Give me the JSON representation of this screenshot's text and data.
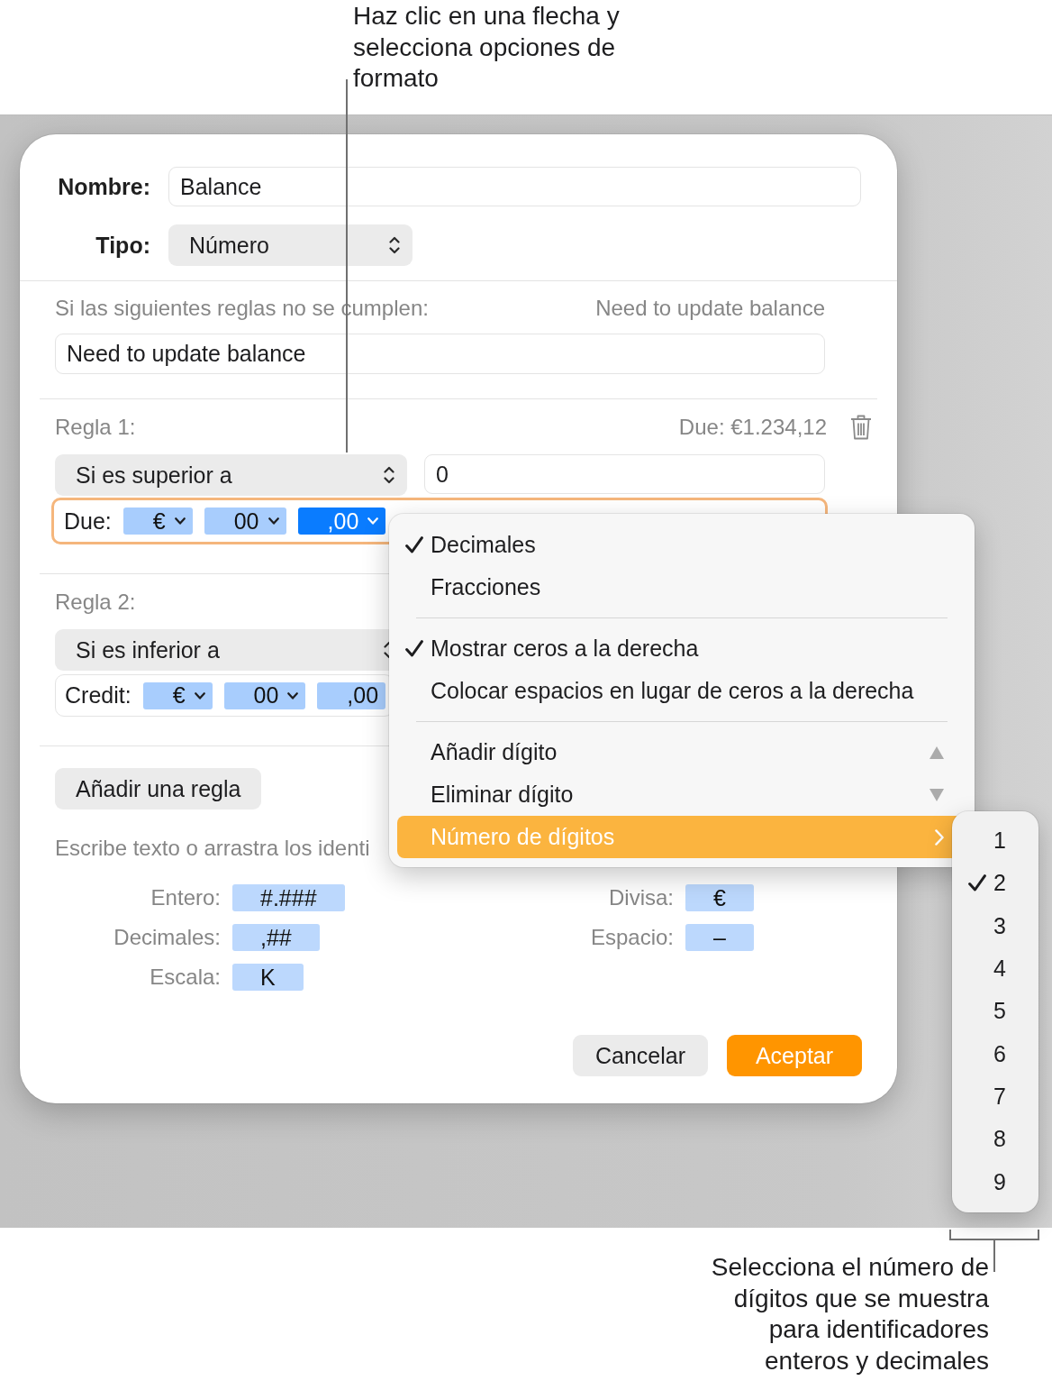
{
  "annotations": {
    "top": "Haz clic en una flecha y selecciona opciones de formato",
    "bottom": "Selecciona el número de dígitos que se muestra para identificadores enteros y decimales"
  },
  "dialog": {
    "fields": [
      {
        "label": "Nombre:",
        "kind": "text",
        "value": "Balance"
      },
      {
        "label": "Tipo:",
        "kind": "select",
        "value": "Número"
      }
    ],
    "fallback": {
      "label": "Si las siguientes reglas no se cumplen:",
      "preview": "Need to update balance",
      "value": "Need to update balance"
    },
    "rules": [
      {
        "label": "Regla 1:",
        "preview": "Due: €1.234,12",
        "condition": "Si es superior a",
        "value": "0",
        "format": {
          "label": "Due:",
          "focused": true,
          "tokens": [
            {
              "text": "€",
              "selected": false,
              "dropdown": true
            },
            {
              "text": "00",
              "selected": false,
              "dropdown": true
            },
            {
              "text": ",00",
              "selected": true,
              "dropdown": true
            }
          ]
        }
      },
      {
        "label": "Regla 2:",
        "condition": "Si es inferior a",
        "format": {
          "label": "Credit:",
          "focused": false,
          "tokens": [
            {
              "text": "€",
              "selected": false,
              "dropdown": true
            },
            {
              "text": "00",
              "selected": false,
              "dropdown": true
            },
            {
              "text": ",00",
              "selected": false,
              "dropdown": false
            }
          ]
        }
      }
    ],
    "add_rule": "Añadir una regla",
    "hint": "Escribe texto o arrastra los identi",
    "identifier_rows": [
      {
        "cells": [
          {
            "label": "Entero:",
            "token": "#.###"
          },
          {
            "label": "Divisa:",
            "token": "€"
          }
        ]
      },
      {
        "cells": [
          {
            "label": "Decimales:",
            "token": ",##"
          },
          {
            "label": "Espacio:",
            "token": "–"
          }
        ]
      },
      {
        "cells": [
          {
            "label": "Escala:",
            "token": "K"
          }
        ]
      }
    ],
    "buttons": [
      {
        "label": "Cancelar",
        "kind": "secondary"
      },
      {
        "label": "Aceptar",
        "kind": "primary"
      }
    ]
  },
  "menu": {
    "items": [
      {
        "kind": "option",
        "label": "Decimales",
        "checked": true,
        "selected": false
      },
      {
        "kind": "option",
        "label": "Fracciones",
        "checked": false,
        "selected": false
      },
      {
        "kind": "separator"
      },
      {
        "kind": "option",
        "label": "Mostrar ceros a la derecha",
        "checked": true,
        "selected": false
      },
      {
        "kind": "option",
        "label": "Colocar espacios en lugar de ceros a la derecha",
        "checked": false,
        "selected": false
      },
      {
        "kind": "separator"
      },
      {
        "kind": "increase",
        "label": "Añadir dígito",
        "selected": false
      },
      {
        "kind": "decrease",
        "label": "Eliminar dígito",
        "selected": false
      },
      {
        "kind": "submenu",
        "label": "Número de dígitos",
        "selected": true
      }
    ]
  },
  "submenu": {
    "items": [
      {
        "label": "1",
        "checked": false
      },
      {
        "label": "2",
        "checked": true
      },
      {
        "label": "3",
        "checked": false
      },
      {
        "label": "4",
        "checked": false
      },
      {
        "label": "5",
        "checked": false
      },
      {
        "label": "6",
        "checked": false
      },
      {
        "label": "7",
        "checked": false
      },
      {
        "label": "8",
        "checked": false
      },
      {
        "label": "9",
        "checked": false
      }
    ]
  }
}
